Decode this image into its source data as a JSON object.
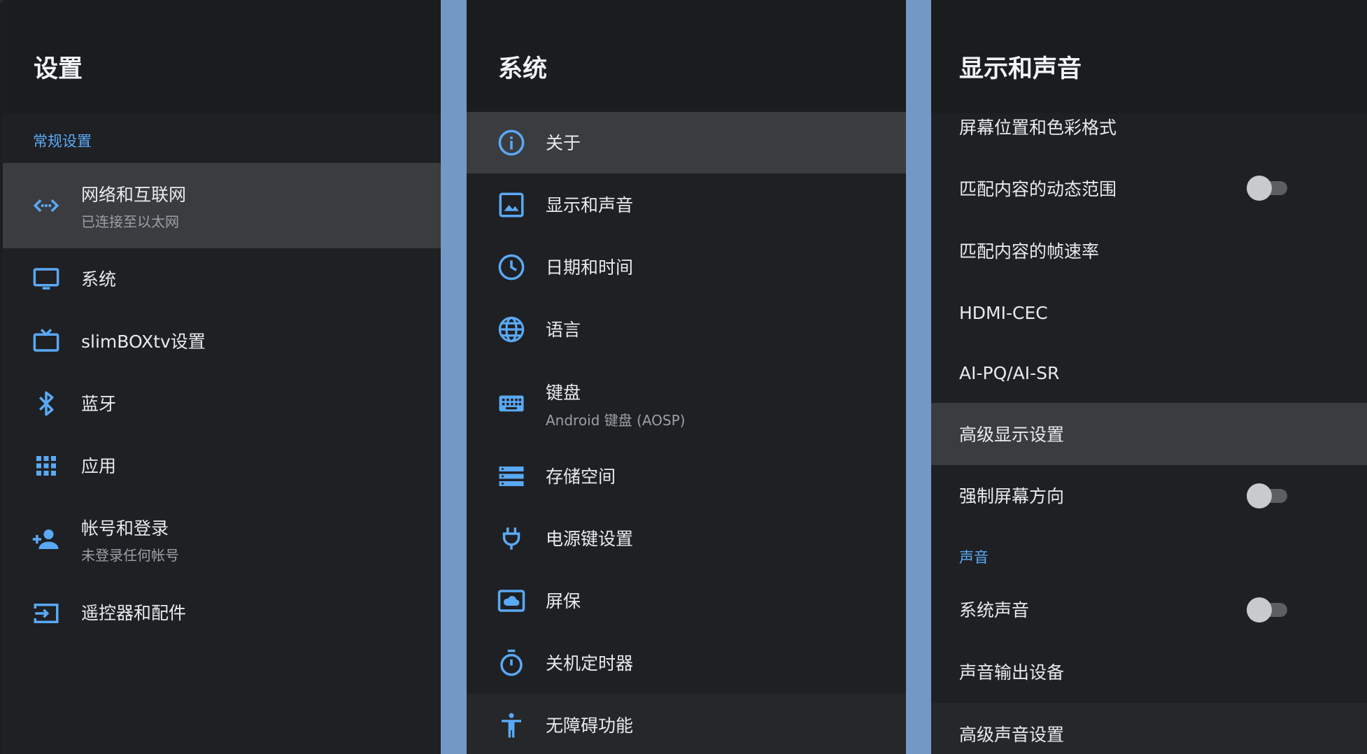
{
  "left_panel": {
    "title": "设置",
    "section": "常规设置",
    "items": [
      {
        "label": "网络和互联网",
        "sub": "已连接至以太网",
        "icon": "network-icon"
      },
      {
        "label": "系统",
        "sub": "",
        "icon": "monitor-icon"
      },
      {
        "label": "slimBOXtv设置",
        "sub": "",
        "icon": "tv-icon"
      },
      {
        "label": "蓝牙",
        "sub": "",
        "icon": "bluetooth-icon"
      },
      {
        "label": "应用",
        "sub": "",
        "icon": "apps-grid-icon"
      },
      {
        "label": "帐号和登录",
        "sub": "未登录任何帐号",
        "icon": "add-person-icon"
      },
      {
        "label": "遥控器和配件",
        "sub": "",
        "icon": "input-icon"
      }
    ]
  },
  "middle_panel": {
    "title": "系统",
    "items": [
      {
        "label": "关于",
        "sub": "",
        "icon": "info-icon"
      },
      {
        "label": "显示和声音",
        "sub": "",
        "icon": "image-icon"
      },
      {
        "label": "日期和时间",
        "sub": "",
        "icon": "clock-icon"
      },
      {
        "label": "语言",
        "sub": "",
        "icon": "globe-icon"
      },
      {
        "label": "键盘",
        "sub": "Android 键盘 (AOSP)",
        "icon": "keyboard-icon"
      },
      {
        "label": "存储空间",
        "sub": "",
        "icon": "storage-icon"
      },
      {
        "label": "电源键设置",
        "sub": "",
        "icon": "power-plug-icon"
      },
      {
        "label": "屏保",
        "sub": "",
        "icon": "screensaver-icon"
      },
      {
        "label": "关机定时器",
        "sub": "",
        "icon": "timer-icon"
      },
      {
        "label": "无障碍功能",
        "sub": "",
        "icon": "accessibility-icon"
      }
    ]
  },
  "right_panel": {
    "title": "显示和声音",
    "items": [
      {
        "label": "屏幕位置和色彩格式",
        "toggle": null
      },
      {
        "label": "匹配内容的动态范围",
        "toggle": "off"
      },
      {
        "label": "匹配内容的帧速率",
        "toggle": null
      },
      {
        "label": "HDMI-CEC",
        "toggle": null
      },
      {
        "label": "AI-PQ/AI-SR",
        "toggle": null
      },
      {
        "label": "高级显示设置",
        "toggle": null
      },
      {
        "label": "强制屏幕方向",
        "toggle": "off"
      }
    ],
    "sound_section": "声音",
    "sound_items": [
      {
        "label": "系统声音",
        "toggle": "off"
      },
      {
        "label": "声音输出设备",
        "toggle": null
      },
      {
        "label": "高级声音设置",
        "toggle": null
      }
    ]
  },
  "colors": {
    "accent": "#5aa9f5",
    "divider": "#7298c6",
    "panel_bg": "#1f2023",
    "selected_bg": "#3b3c3f"
  }
}
